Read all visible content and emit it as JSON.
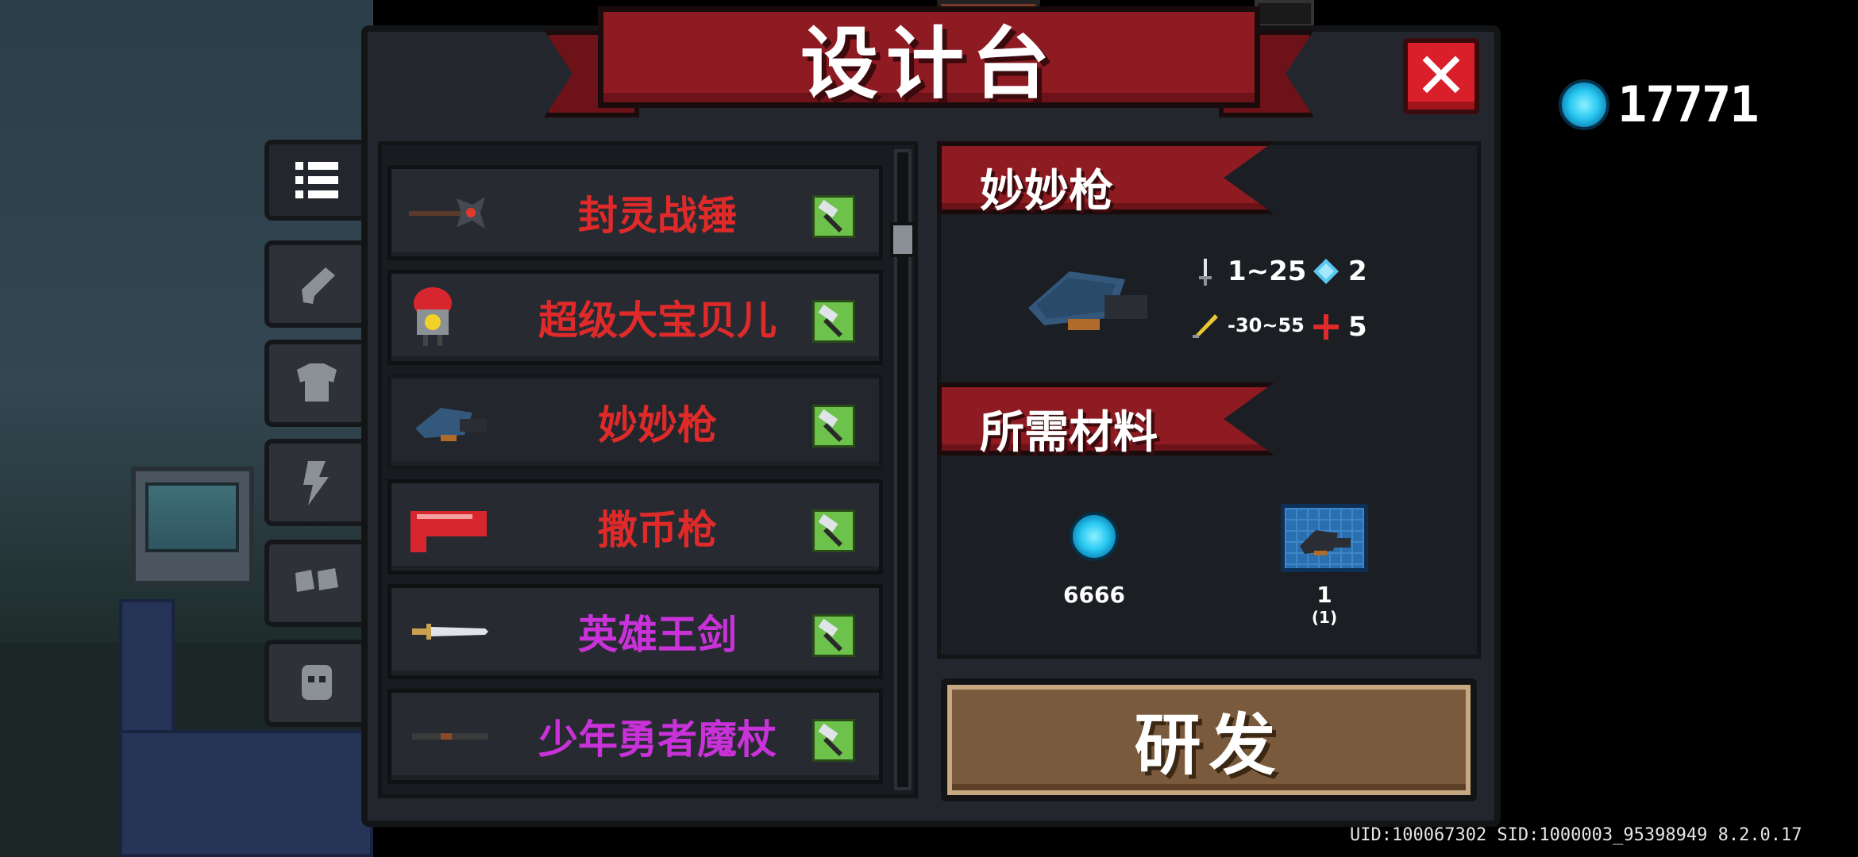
{
  "header": {
    "title": "设计台",
    "close_label": "✕"
  },
  "currency": {
    "icon": "gem-coin-icon",
    "amount": "17771"
  },
  "side_tabs": [
    {
      "name": "list-icon",
      "active": true
    },
    {
      "name": "gun-icon",
      "active": false
    },
    {
      "name": "armor-icon",
      "active": false
    },
    {
      "name": "lightning-icon",
      "active": false
    },
    {
      "name": "boots-icon",
      "active": false
    },
    {
      "name": "pet-icon",
      "active": false
    }
  ],
  "recipes": [
    {
      "name": "封灵战锤",
      "color": "#e02a2a",
      "icon": "hammer-weapon-icon"
    },
    {
      "name": "超级大宝贝儿",
      "color": "#e02a2a",
      "icon": "nuke-bomb-icon"
    },
    {
      "name": "妙妙枪",
      "color": "#e02a2a",
      "icon": "roof-gun-icon"
    },
    {
      "name": "撒币枪",
      "color": "#e02a2a",
      "icon": "red-gun-icon"
    },
    {
      "name": "英雄王剑",
      "color": "#c832d8",
      "icon": "sword-icon"
    },
    {
      "name": "少年勇者魔杖",
      "color": "#c832d8",
      "icon": "staff-icon"
    }
  ],
  "detail": {
    "item_name": "妙妙枪",
    "stats": {
      "damage": "1~25",
      "energy": "2",
      "inaccuracy": "-30~55",
      "crit": "5"
    },
    "materials_title": "所需材料",
    "materials": [
      {
        "icon": "gem-coin-icon",
        "amount": "6666",
        "owned": ""
      },
      {
        "icon": "blueprint-icon",
        "amount": "1",
        "owned": "(1)"
      }
    ],
    "develop_label": "研发"
  },
  "footer": {
    "uid_text": "UID:100067302 SID:1000003_95398949 8.2.0.17"
  },
  "colors": {
    "ribbon": "#8e1a22",
    "panel": "#23272d",
    "button": "#7a5a3c",
    "accent_green": "#6cc24a"
  }
}
